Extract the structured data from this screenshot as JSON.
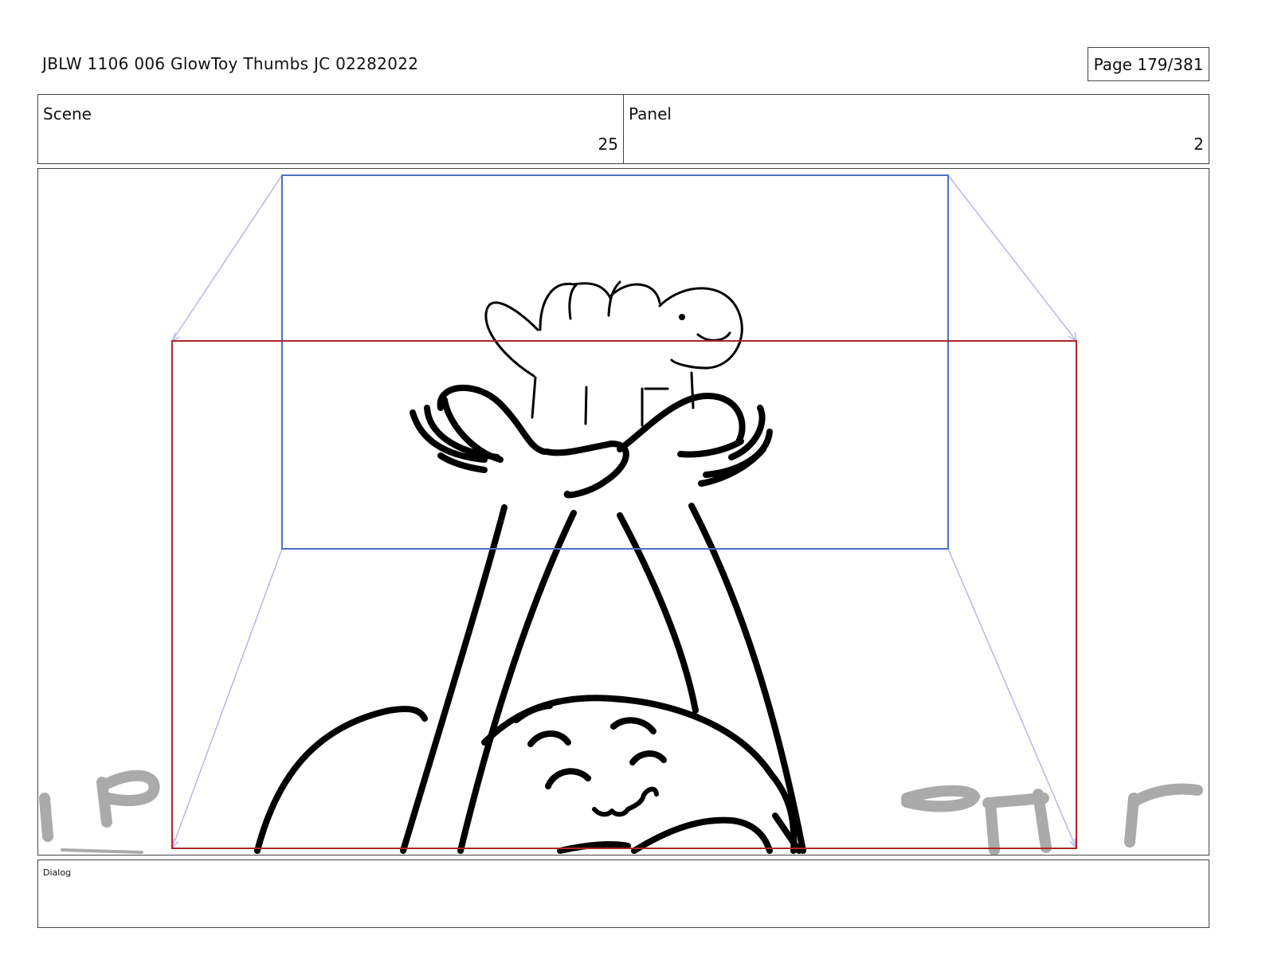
{
  "header": {
    "document_title": "JBLW 1106 006 GlowToy Thumbs JC 02282022",
    "page_indicator": "Page 179/381"
  },
  "scene": {
    "label": "Scene",
    "value": "25"
  },
  "panel": {
    "label": "Panel",
    "value": "2"
  },
  "dialog": {
    "label": "Dialog",
    "text": ""
  },
  "frame_colors": {
    "camera_start": "#4a72c4",
    "camera_end": "#b0242c",
    "guide_lines": "#b9b6ea",
    "sketch": "#000000",
    "background_sketch": "#aaaaaa"
  }
}
